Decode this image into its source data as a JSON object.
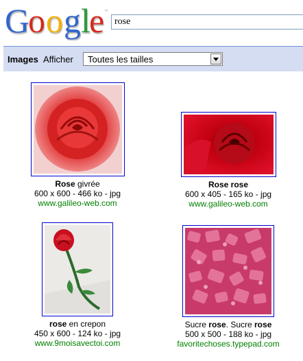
{
  "header": {
    "logo_text": "Google",
    "search_query": "rose"
  },
  "toolbar": {
    "section_label": "Images",
    "afficher_label": "Afficher",
    "size_filter_value": "Toutes les tailles"
  },
  "results": [
    {
      "title_bold": "Rose",
      "title_rest": " givrée",
      "meta": "600 x 600 - 466 ko - jpg",
      "url": "www.galileo-web.com"
    },
    {
      "title_bold": "Rose rose",
      "title_rest": "",
      "meta": "600 x 405 - 165 ko - jpg",
      "url": "www.galileo-web.com"
    },
    {
      "title_bold": "rose",
      "title_rest": " en crepon",
      "meta": "450 x 600 - 124 ko - jpg",
      "url": "www.9moisavectoi.com"
    },
    {
      "title_part1": "Sucre ",
      "title_bold1": "rose",
      "title_part2": ". Sucre ",
      "title_bold2": "rose",
      "meta": "500 x 500 - 188 ko - jpg",
      "url": "favoritechoses.typepad.com"
    }
  ],
  "colors": {
    "toolbar_bg": "#d5ddf3",
    "toolbar_border": "#6b90da",
    "thumb_border": "#0000cc",
    "url_green": "#008000"
  }
}
